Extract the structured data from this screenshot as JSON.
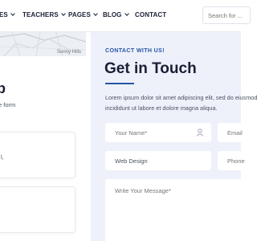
{
  "nav": {
    "items": [
      {
        "label": "ES",
        "has_dropdown": true
      },
      {
        "label": "TEACHERS",
        "has_dropdown": true
      },
      {
        "label": "PAGES",
        "has_dropdown": true
      },
      {
        "label": "BLOG",
        "has_dropdown": true
      },
      {
        "label": "CONTACT",
        "has_dropdown": false
      }
    ],
    "search_placeholder": "Search for ..."
  },
  "left": {
    "map_label": "Sunny Hills",
    "heading": "p",
    "text": "e form",
    "card1_text": "l,"
  },
  "contact": {
    "eyebrow": "CONTACT WITH US!",
    "title": "Get in Touch",
    "description": "Lorem ipsum dolor sit amet adipiscing elit, sed do eiusmod incididunt ut labore et dolore magna aliqua.",
    "fields": {
      "name_placeholder": "Your Name*",
      "email_placeholder": "Email",
      "service_value": "Web Design",
      "phone_placeholder": "Phone",
      "message_placeholder": "Write Your Message*"
    }
  },
  "colors": {
    "accent": "#2454a6",
    "panel_bg": "#eef1fa",
    "text_dark": "#1a1f36"
  }
}
